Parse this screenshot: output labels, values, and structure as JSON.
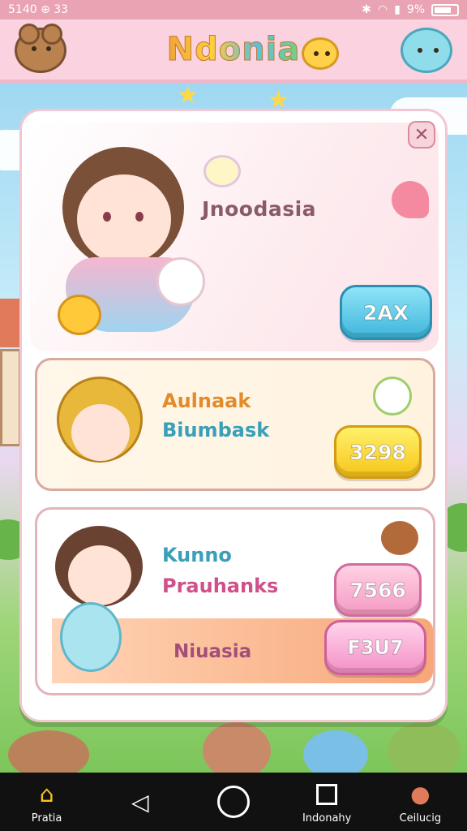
{
  "status_bar": {
    "time": "5140 ⊕ 33",
    "battery": "9%",
    "signal_icons": [
      "bluetooth-icon",
      "wifi-icon",
      "signal-icon"
    ]
  },
  "header": {
    "title": "Ndonia"
  },
  "modal": {
    "hero": {
      "title": "Jnoodasia",
      "button": "2AX"
    },
    "card1": {
      "line1": "Aulnaak",
      "line2": "Biumbask",
      "button": "3298"
    },
    "card2": {
      "line1": "Kunno",
      "line2": "Prauhanks",
      "button": "7566",
      "strip_label": "Niuasia",
      "strip_button": "F3U7"
    }
  },
  "nav": {
    "items": [
      {
        "label": "Pratia",
        "icon": "home-icon"
      },
      {
        "label": "",
        "icon": "back-icon"
      },
      {
        "label": "",
        "icon": "home-circle-icon"
      },
      {
        "label": "Indonahy",
        "icon": "recents-icon"
      },
      {
        "label": "Ceilucig",
        "icon": "profile-icon"
      }
    ]
  },
  "colors": {
    "accent_pink": "#fbd2df",
    "button_blue": "#3fb6dc",
    "button_yellow": "#f7c51a",
    "button_pink": "#f59ac3"
  }
}
